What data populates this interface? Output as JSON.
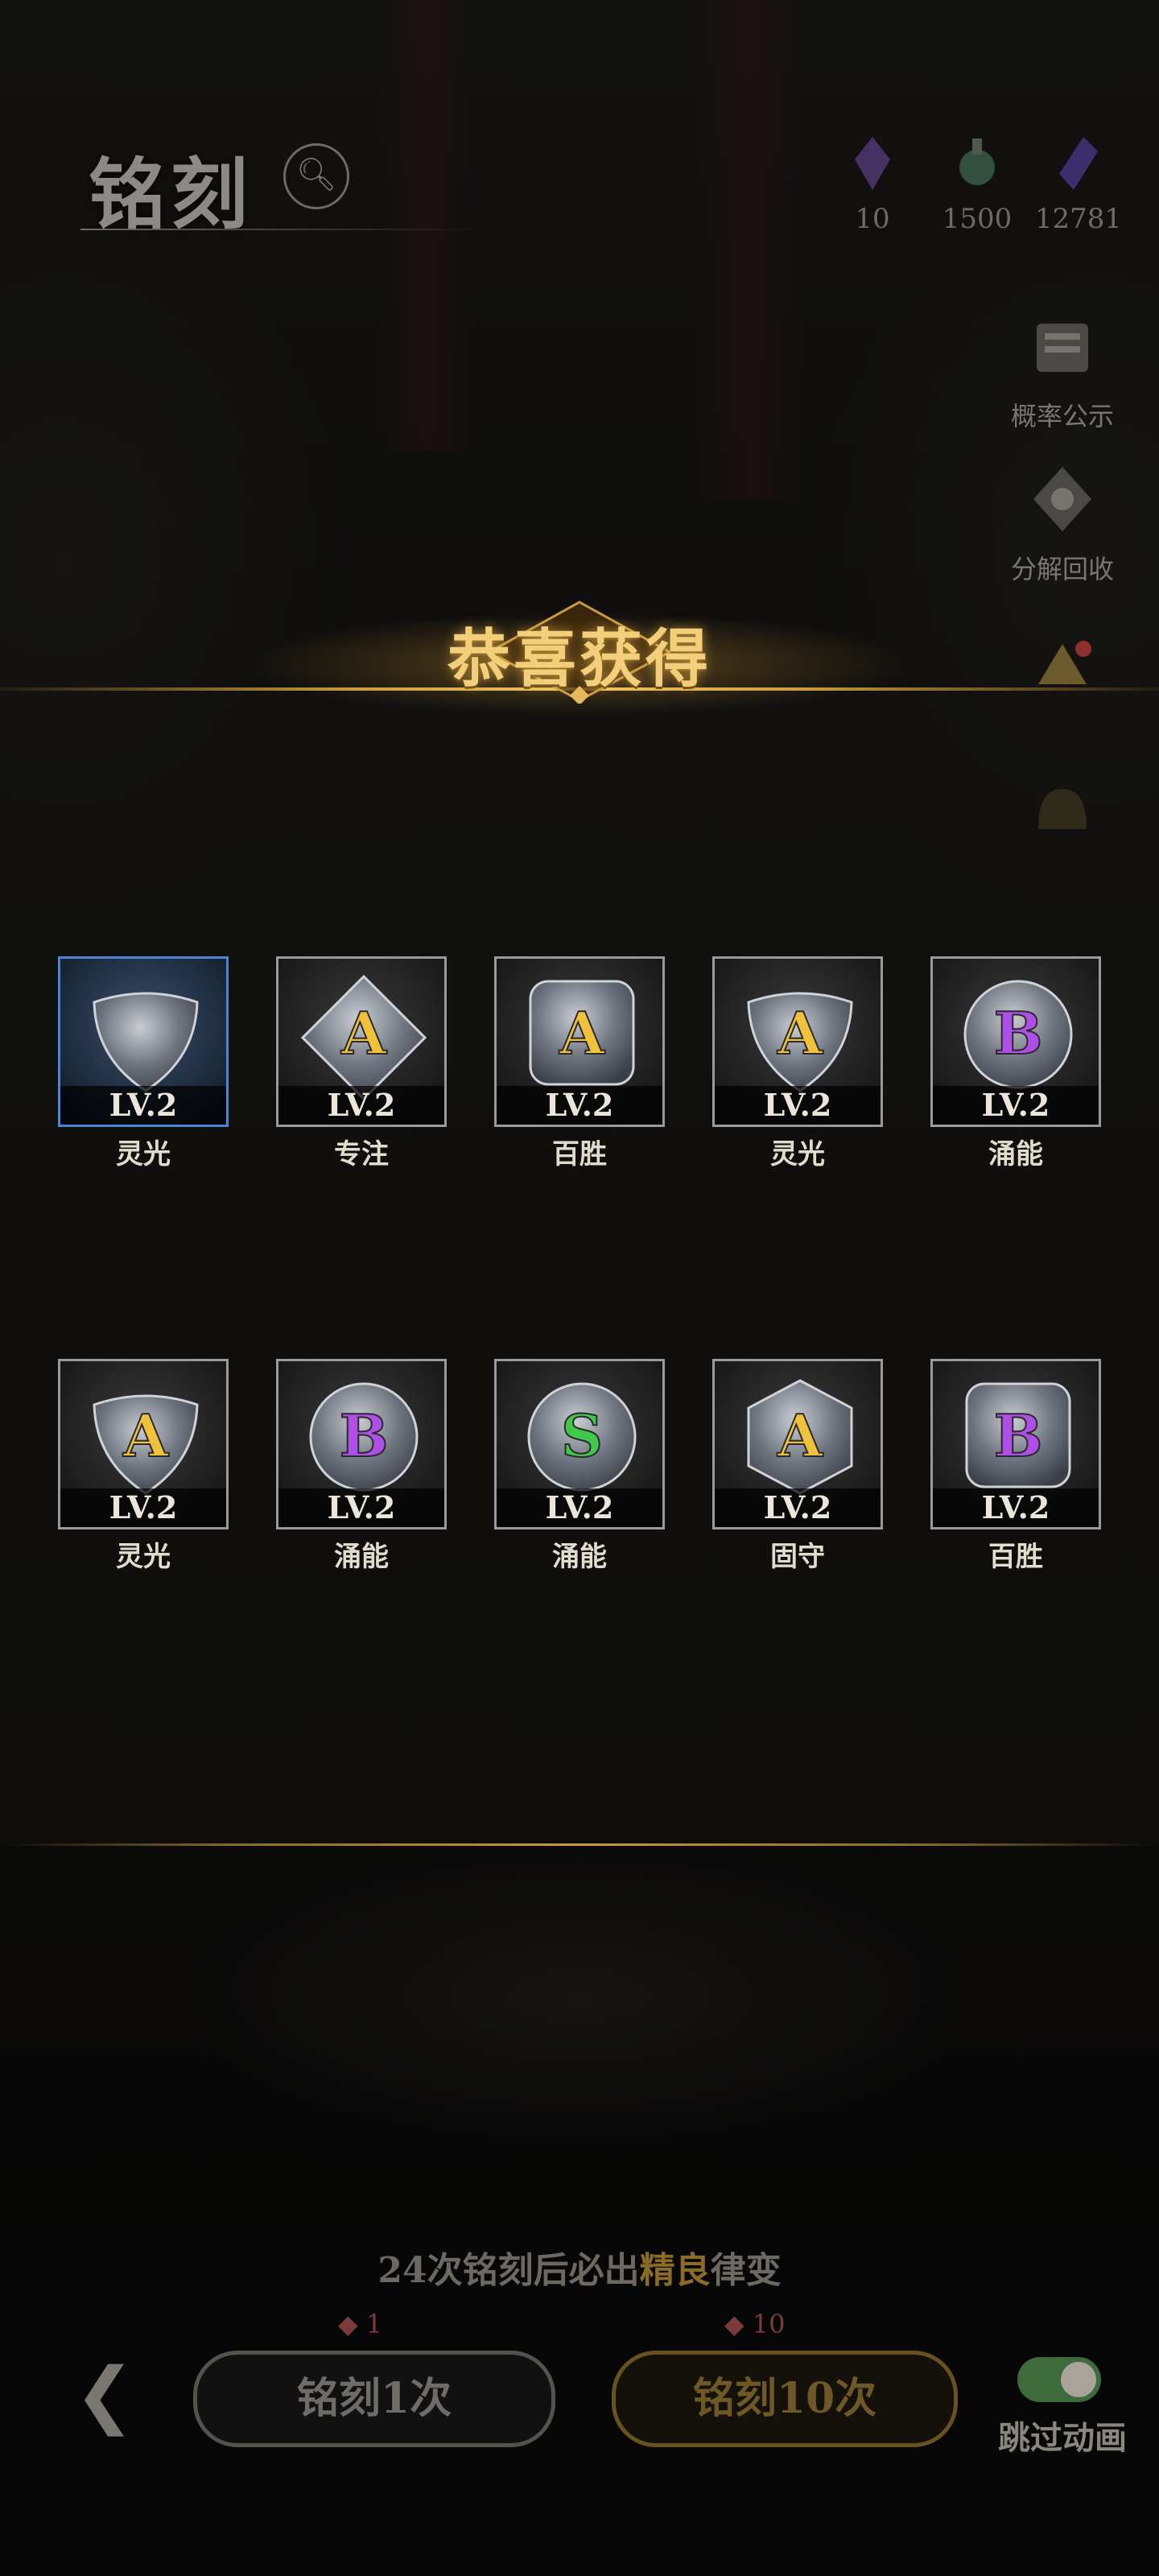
{
  "header": {
    "title": "铭刻"
  },
  "currencies": [
    {
      "icon": "purple-crystal-icon",
      "value": "10"
    },
    {
      "icon": "green-potion-icon",
      "value": "1500"
    },
    {
      "icon": "violet-shard-icon",
      "value": "12781"
    }
  ],
  "side_buttons": [
    {
      "icon": "probability-notice-icon",
      "label": "概率公示"
    },
    {
      "icon": "decompose-reward-icon",
      "label": "分解回收"
    },
    {
      "icon": "shop-icon",
      "label": ""
    },
    {
      "icon": "helmet-icon",
      "label": ""
    }
  ],
  "banner": {
    "title": "恭喜获得"
  },
  "results": [
    {
      "level": "LV.2",
      "name": "灵光",
      "rune": "",
      "shape": "shield",
      "selected": true
    },
    {
      "level": "LV.2",
      "name": "专注",
      "rune": "A",
      "shape": "diamond",
      "selected": false
    },
    {
      "level": "LV.2",
      "name": "百胜",
      "rune": "A",
      "shape": "square",
      "selected": false
    },
    {
      "level": "LV.2",
      "name": "灵光",
      "rune": "A",
      "shape": "shield",
      "selected": false
    },
    {
      "level": "LV.2",
      "name": "涌能",
      "rune": "B",
      "shape": "circle",
      "selected": false
    },
    {
      "level": "LV.2",
      "name": "灵光",
      "rune": "A",
      "shape": "shield",
      "selected": false
    },
    {
      "level": "LV.2",
      "name": "涌能",
      "rune": "B",
      "shape": "circle",
      "selected": false
    },
    {
      "level": "LV.2",
      "name": "涌能",
      "rune": "S",
      "shape": "circle",
      "selected": false
    },
    {
      "level": "LV.2",
      "name": "固守",
      "rune": "A",
      "shape": "hexagon",
      "selected": false
    },
    {
      "level": "LV.2",
      "name": "百胜",
      "rune": "B",
      "shape": "square",
      "selected": false
    }
  ],
  "rune_colors": {
    "A": "#f0c23c",
    "B": "#b04ee8",
    "S": "#3fc84a"
  },
  "footer": {
    "pity_prefix": "24次铭刻后必出",
    "pity_highlight": "精良",
    "pity_suffix": "律变",
    "draw_one_label": "铭刻1次",
    "draw_one_cost": "1",
    "draw_ten_label": "铭刻10次",
    "draw_ten_cost": "10",
    "skip_label": "跳过动画",
    "skip_on": true
  }
}
